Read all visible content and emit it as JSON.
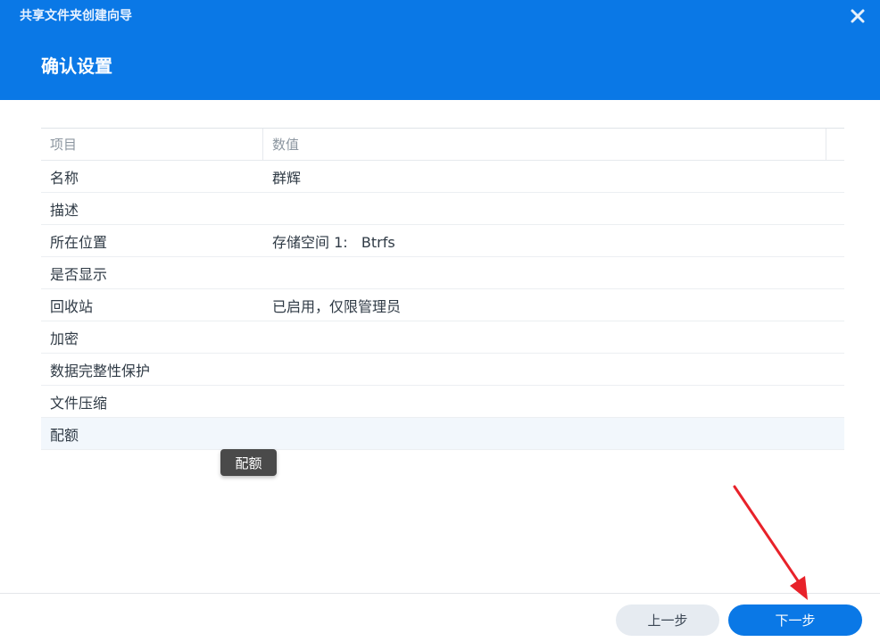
{
  "window": {
    "title": "共享文件夹创建向导",
    "close_icon": "close-icon"
  },
  "step": {
    "title": "确认设置"
  },
  "table": {
    "headers": [
      "项目",
      "数值"
    ],
    "rows": [
      {
        "key": "名称",
        "value": "群辉"
      },
      {
        "key": "描述",
        "value": ""
      },
      {
        "key": "所在位置",
        "value": "存储空间 1:   Btrfs"
      },
      {
        "key": "是否显示",
        "value": ""
      },
      {
        "key": "回收站",
        "value": "已启用，仅限管理员"
      },
      {
        "key": "加密",
        "value": ""
      },
      {
        "key": "数据完整性保护",
        "value": ""
      },
      {
        "key": "文件压缩",
        "value": ""
      },
      {
        "key": "配额",
        "value": ""
      }
    ]
  },
  "tooltip": {
    "text": "配额"
  },
  "footer": {
    "prev_label": "上一步",
    "next_label": "下一步"
  },
  "colors": {
    "header": "#0a78e6",
    "primary_button": "#0a78e6",
    "secondary_button": "#e6ebf1",
    "annotation_arrow": "#e8222a"
  }
}
